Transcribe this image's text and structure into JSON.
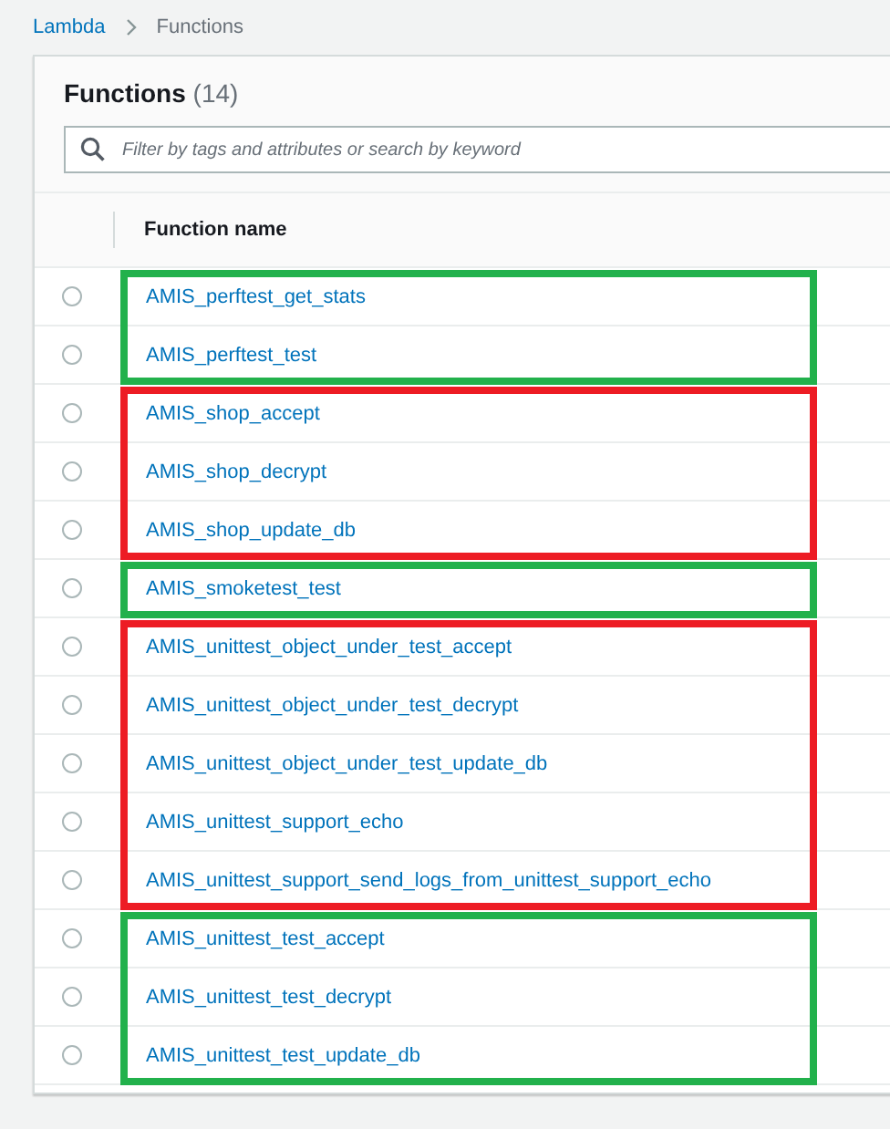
{
  "breadcrumb": [
    {
      "label": "Lambda",
      "link": true
    },
    {
      "label": "Functions",
      "link": false
    }
  ],
  "panel": {
    "title": "Functions",
    "count": "(14)"
  },
  "search": {
    "placeholder": "Filter by tags and attributes or search by keyword"
  },
  "table": {
    "columns": [
      "Function name"
    ],
    "groups": [
      {
        "color": "#22b14c",
        "rows": [
          {
            "name": "AMIS_perftest_get_stats",
            "selected": false
          },
          {
            "name": "AMIS_perftest_test",
            "selected": false
          }
        ]
      },
      {
        "color": "#ed1c24",
        "rows": [
          {
            "name": "AMIS_shop_accept",
            "selected": false
          },
          {
            "name": "AMIS_shop_decrypt",
            "selected": false
          },
          {
            "name": "AMIS_shop_update_db",
            "selected": false
          }
        ]
      },
      {
        "color": "#22b14c",
        "rows": [
          {
            "name": "AMIS_smoketest_test",
            "selected": false
          }
        ]
      },
      {
        "color": "#ed1c24",
        "rows": [
          {
            "name": "AMIS_unittest_object_under_test_accept",
            "selected": false
          },
          {
            "name": "AMIS_unittest_object_under_test_decrypt",
            "selected": false
          },
          {
            "name": "AMIS_unittest_object_under_test_update_db",
            "selected": false
          },
          {
            "name": "AMIS_unittest_support_echo",
            "selected": false
          },
          {
            "name": "AMIS_unittest_support_send_logs_from_unittest_support_echo",
            "selected": false
          }
        ]
      },
      {
        "color": "#22b14c",
        "rows": [
          {
            "name": "AMIS_unittest_test_accept",
            "selected": false
          },
          {
            "name": "AMIS_unittest_test_decrypt",
            "selected": false
          },
          {
            "name": "AMIS_unittest_test_update_db",
            "selected": false
          }
        ]
      }
    ]
  }
}
